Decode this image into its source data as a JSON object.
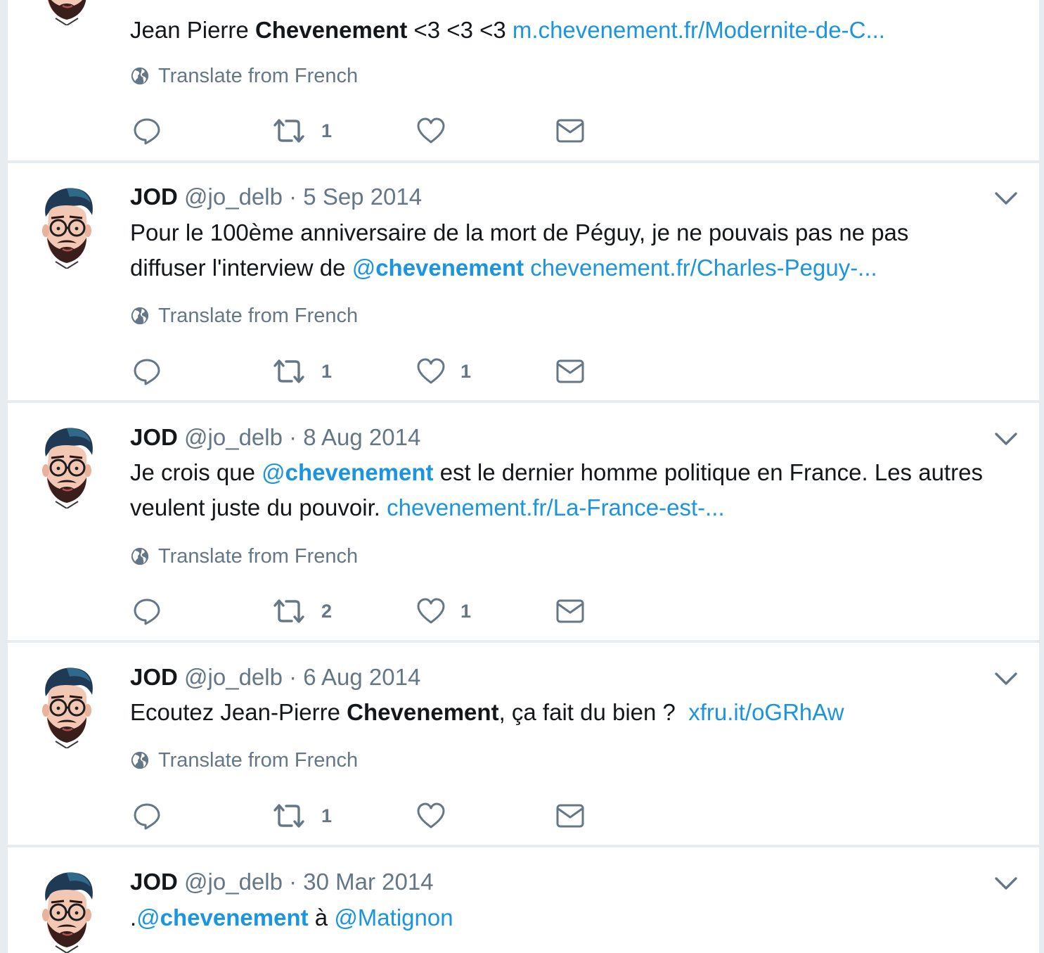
{
  "tweets": [
    {
      "partial": true,
      "line1": "Jean Pierre ",
      "line1_bold": "Chevenement",
      "line1_rest": " <3 <3 <3 ",
      "link": "m.chevenement.fr/Modernite-de-C...",
      "translate": "Translate from French",
      "retweets": "1",
      "likes": ""
    },
    {
      "name": "JOD",
      "handle": "@jo_delb",
      "sep": " · ",
      "date": "5 Sep 2014",
      "line1": "Pour le 100ème anniversaire de la mort de Péguy, je ne pouvais pas ne pas",
      "line2_pre": "diffuser l'interview de ",
      "mention_at": "@",
      "mention_name": "chevenement",
      "link": "chevenement.fr/Charles-Peguy-...",
      "translate": "Translate from French",
      "retweets": "1",
      "likes": "1"
    },
    {
      "name": "JOD",
      "handle": "@jo_delb",
      "sep": " · ",
      "date": "8 Aug 2014",
      "line1_pre": "Je crois que ",
      "mention_at": "@",
      "mention_name": "chevenement",
      "line1_post": " est le dernier homme politique en France. Les autres",
      "line2_pre": "veulent juste du pouvoir. ",
      "link": "chevenement.fr/La-France-est-...",
      "translate": "Translate from French",
      "retweets": "2",
      "likes": "1"
    },
    {
      "name": "JOD",
      "handle": "@jo_delb",
      "sep": " · ",
      "date": "6 Aug 2014",
      "line1_pre": "Ecoutez Jean-Pierre ",
      "line1_bold": "Chevenement",
      "line1_post": ", ça fait du bien ?  ",
      "link": "xfru.it/oGRhAw",
      "translate": "Translate from French",
      "retweets": "1",
      "likes": ""
    },
    {
      "name": "JOD",
      "handle": "@jo_delb",
      "sep": " · ",
      "date": "30 Mar 2014",
      "line1_pre": ".",
      "mention_at": "@",
      "mention_name": "chevenement",
      "line1_mid": " à ",
      "mention2": "@Matignon"
    }
  ],
  "icons": {
    "reply": "reply-icon",
    "retweet": "retweet-icon",
    "like": "heart-icon",
    "dm": "envelope-icon",
    "globe": "globe-icon",
    "caret": "chevron-down-icon"
  },
  "colors": {
    "link": "#1b95e0",
    "muted": "#657786",
    "text": "#14171a",
    "background": "#e6ecf0"
  }
}
